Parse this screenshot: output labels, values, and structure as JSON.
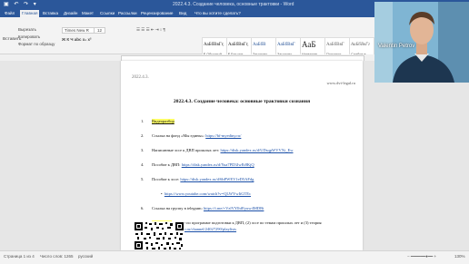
{
  "window": {
    "title": "2022.4.3. Создание человека, основные трактовки - Word"
  },
  "ribbon_tabs": [
    "Файл",
    "Главная",
    "Вставка",
    "Дизайн",
    "Макет",
    "Ссылки",
    "Рассылки",
    "Рецензирование",
    "Вид",
    "Что вы хотите сделать?"
  ],
  "clipboard": {
    "paste": "Вставить",
    "cut": "Вырезать",
    "copy": "Копировать",
    "format": "Формат по образцу",
    "label": "Буфер обмена"
  },
  "font": {
    "name": "Times New R",
    "size": "12",
    "label": "Шрифт"
  },
  "paragraph_label": "Абзац",
  "styles_label": "Стили",
  "styles": [
    {
      "sample": "АаБбВвГг,",
      "name": "¶ Обычный"
    },
    {
      "sample": "АаБбВвГг,",
      "name": "¶ Без инт..."
    },
    {
      "sample": "АаБбВ",
      "name": "Заголово..."
    },
    {
      "sample": "АаБбВвГ",
      "name": "Заголово..."
    },
    {
      "sample": "АаБ",
      "name": "Название"
    },
    {
      "sample": "АаБбВвГ",
      "name": "Подзагол..."
    },
    {
      "sample": "АаБбВвГг",
      "name": "Слабое в..."
    },
    {
      "sample": "АаБбВвГг",
      "name": "Выделение"
    }
  ],
  "webcam": {
    "name": "Valentin Petrov"
  },
  "document": {
    "header_left": "2022.4.3.",
    "header_right": "www.dvi-legal.ru",
    "title": "2022.4.3. Создание человека: основные трактовки сознания",
    "items": [
      {
        "num": "1.",
        "text": "",
        "link": "Видеоразбор"
      },
      {
        "num": "2.",
        "text": "Ссылка на фонд «Мы едины»: ",
        "link": "https://bf-myedinу.ru/"
      },
      {
        "num": "3.",
        "text": "Написанные эссе к ДВП прошлых лет: ",
        "link": "https://disk.yandex.ru/d/UDsqpWVVXi_Ew"
      },
      {
        "num": "4.",
        "text": "Пособие к ДВП: ",
        "link": "https://disk.yandex.ru/d/Yua7PD3JwEt8KjQ"
      },
      {
        "num": "5.",
        "text": "Пособие к эссе: ",
        "link": "https://disk.yandex.ru/d/6bPWEV1eD5AFdg"
      },
      {
        "num": "6.",
        "text": "Ссылка на группу в telegram: ",
        "link": "https://t.me/+VzlVYlhfEyuw4MDBi"
      },
      {
        "num": "7.",
        "text": "(1) эссе по программе подготовки к ДВП, (2) эссе по темам прошлых лет и (3) теория",
        "link": "Плейлисты"
      }
    ],
    "bullet_link": "https://www.youtube.com/watch?v=QLWYwIiGTEc",
    "item7_line2_prefix": "эссе: ",
    "item7_line2_link": "https://youtube.ru/channel/24027290/playlists"
  },
  "status": {
    "page": "Страница 1 из 4",
    "words": "Число слов: 1265",
    "lang": "русский",
    "zoom": "130%"
  }
}
